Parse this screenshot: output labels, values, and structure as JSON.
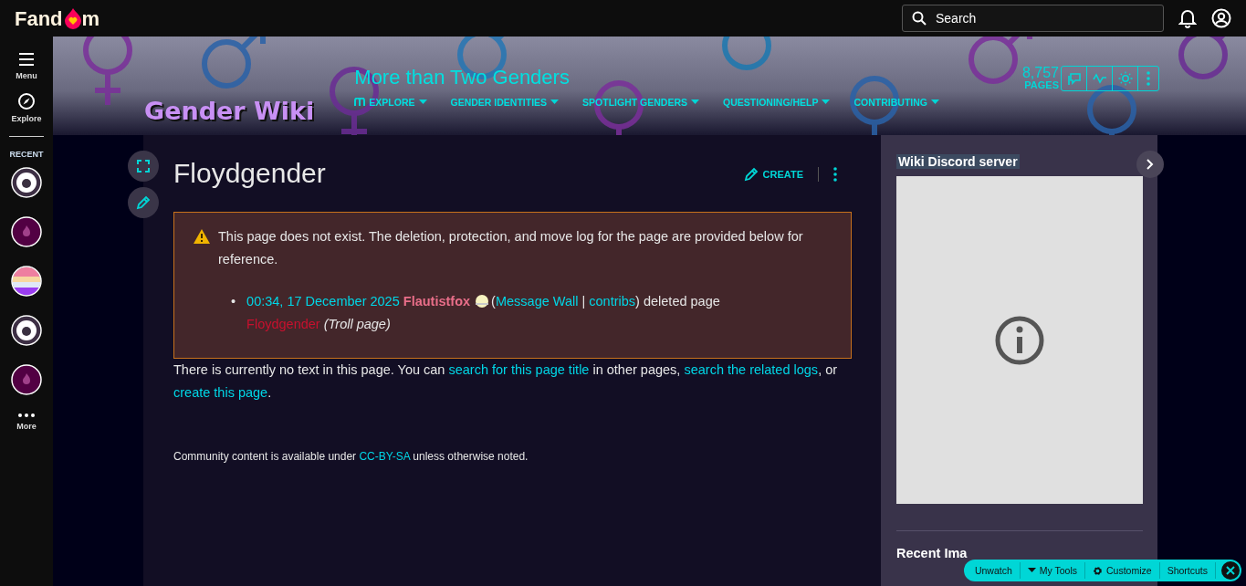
{
  "topbar": {
    "logo_start": "Fand",
    "logo_end": "m",
    "search": {
      "placeholder": "Search"
    }
  },
  "rail": {
    "items": [
      {
        "label": "Menu",
        "kind": "menu"
      },
      {
        "label": "Explore",
        "kind": "explore"
      }
    ],
    "recent_label": "RECENT",
    "recent": [
      {
        "kind": "picture"
      },
      {
        "kind": "default"
      },
      {
        "kind": "picture"
      },
      {
        "kind": "picture"
      },
      {
        "kind": "default"
      }
    ],
    "more": "More"
  },
  "header": {
    "logo": "Gender Wiki",
    "community": "More than Two Genders",
    "nav": [
      {
        "label": "EXPLORE",
        "kind": "explore"
      },
      {
        "label": "GENDER IDENTITIES",
        "kind": "plain"
      },
      {
        "label": "SPOTLIGHT GENDERS",
        "kind": "plain"
      },
      {
        "label": "QUESTIONING/HELP",
        "kind": "plain"
      },
      {
        "label": "CONTRIBUTING",
        "kind": "plain"
      }
    ],
    "page_count": "8,757",
    "page_count_label": "PAGES"
  },
  "article": {
    "title": "Floydgender",
    "create": "CREATE",
    "notice": {
      "text": "This page does not exist. The deletion, protection, and move log for the page are provided below for reference.",
      "entries": [
        {
          "bullet": "•",
          "segments": [
            {
              "kind": "link",
              "text": "00:34, 17 December 2025"
            },
            {
              "kind": "user",
              "text": " Flautistfox"
            },
            {
              "kind": "avatar"
            },
            {
              "kind": "text",
              "text": "("
            },
            {
              "kind": "link",
              "text": "Message Wall"
            },
            {
              "kind": "text",
              "text": " | "
            },
            {
              "kind": "link",
              "text": "contribs"
            },
            {
              "kind": "text",
              "text": ") deleted page "
            },
            {
              "kind": "redlink",
              "text": "Floydgender"
            },
            {
              "kind": "italic",
              "text": "(Troll page)"
            }
          ]
        }
      ]
    },
    "body": [
      {
        "kind": "text",
        "text": "There is currently no text in this page. You can "
      },
      {
        "kind": "link",
        "text": "search for this page title"
      },
      {
        "kind": "text",
        "text": " in other pages, "
      },
      {
        "kind": "link",
        "text": "search the related logs"
      },
      {
        "kind": "text",
        "text": ", or "
      },
      {
        "kind": "link",
        "text": "create this page"
      },
      {
        "kind": "text",
        "text": "."
      }
    ],
    "license": [
      {
        "kind": "text",
        "text": "Community content is available under "
      },
      {
        "kind": "link",
        "text": "CC-BY-SA"
      },
      {
        "kind": "text",
        "text": " unless otherwise noted."
      }
    ]
  },
  "right_rail": {
    "discord_title": "Wiki Discord server",
    "recent_images_title": "Recent Ima"
  },
  "toolbar": {
    "items": [
      {
        "label": "Unwatch",
        "kind": "plain"
      },
      {
        "label": "My Tools",
        "kind": "menu"
      },
      {
        "label": "Customize",
        "kind": "settings"
      },
      {
        "label": "Shortcuts",
        "kind": "plain"
      }
    ]
  }
}
